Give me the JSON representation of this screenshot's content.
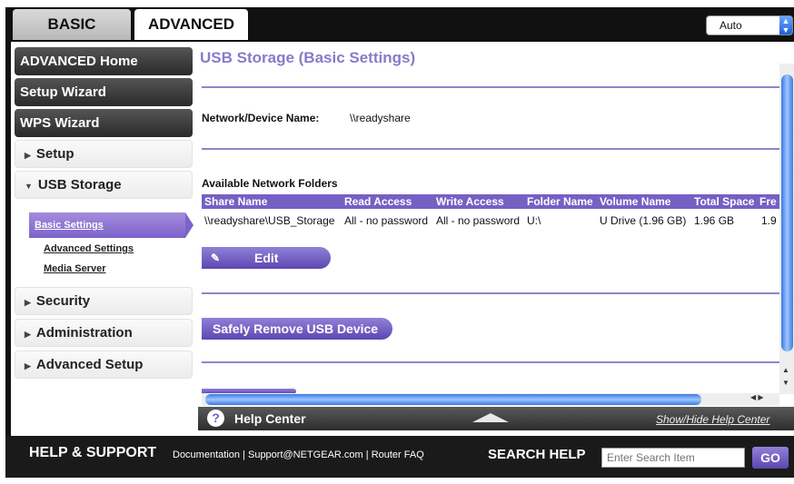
{
  "tabs": {
    "basic": "BASIC",
    "advanced": "ADVANCED"
  },
  "language_select": {
    "value": "Auto"
  },
  "nav": {
    "advanced_home": "ADVANCED Home",
    "setup_wizard": "Setup Wizard",
    "wps_wizard": "WPS Wizard",
    "setup": "Setup",
    "usb_storage": "USB Storage",
    "sub_basic": "Basic Settings",
    "sub_advanced": "Advanced Settings",
    "sub_media": "Media Server",
    "security": "Security",
    "administration": "Administration",
    "advanced_setup": "Advanced Setup"
  },
  "page": {
    "title": "USB Storage (Basic Settings)",
    "device_name_label": "Network/Device Name:",
    "device_name_value": "\\\\readyshare",
    "folders_heading": "Available Network Folders",
    "columns": [
      "Share Name",
      "Read Access",
      "Write Access",
      "Folder Name",
      "Volume Name",
      "Total Space",
      "Fre"
    ],
    "row": [
      "\\\\readyshare\\USB_Storage",
      "All - no password",
      "All - no password",
      "U:\\",
      "U Drive (1.96 GB)",
      "1.96 GB",
      "1.9"
    ],
    "edit_label": "Edit",
    "remove_label": "Safely Remove USB Device"
  },
  "help_center": {
    "title": "Help Center",
    "toggle": "Show/Hide Help Center",
    "icon": "?"
  },
  "footer": {
    "title": "HELP & SUPPORT",
    "link_docs": "Documentation",
    "link_support": "Support@NETGEAR.com",
    "link_faq": "Router FAQ",
    "search_label": "SEARCH HELP",
    "search_placeholder": "Enter Search Item",
    "go_label": "GO"
  }
}
